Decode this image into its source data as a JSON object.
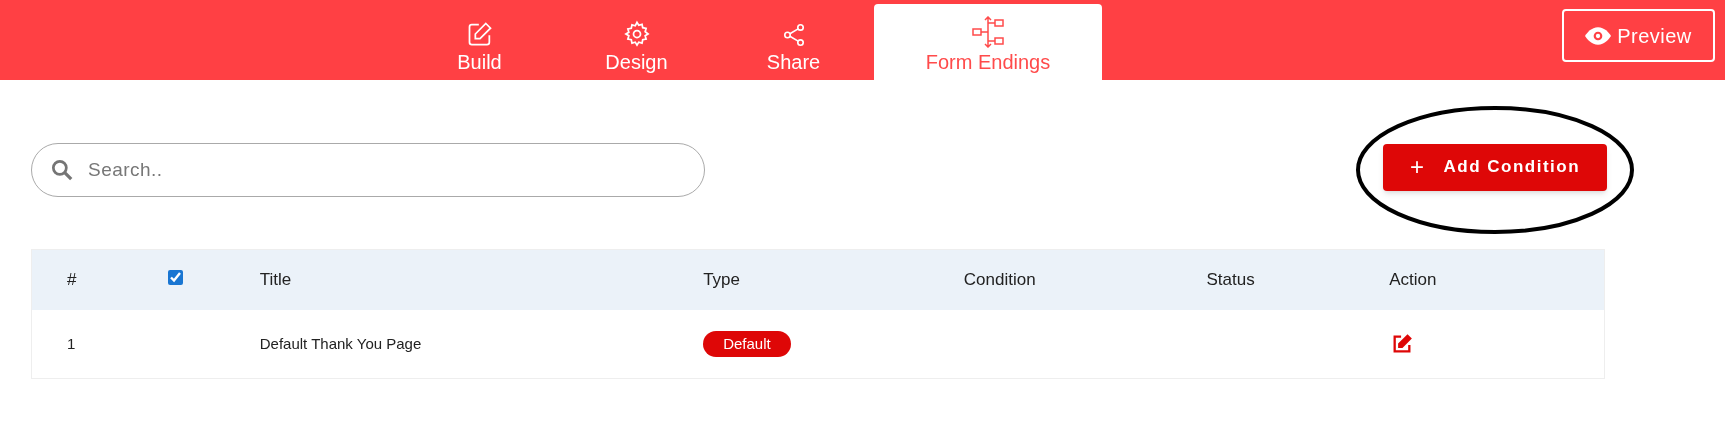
{
  "tabs": [
    {
      "label": "Build",
      "selected": false
    },
    {
      "label": "Design",
      "selected": false
    },
    {
      "label": "Share",
      "selected": false
    },
    {
      "label": "Form Endings",
      "selected": true
    }
  ],
  "preview_button": "Preview",
  "search": {
    "placeholder": "Search.."
  },
  "add_button": {
    "label": "Add Condition",
    "icon": "+"
  },
  "table": {
    "columns": [
      "#",
      "Title",
      "Type",
      "Condition",
      "Status",
      "Action"
    ],
    "select_all_checked": true,
    "rows": [
      {
        "number": "1",
        "title": "Default Thank You Page",
        "type": "Default"
      }
    ]
  }
}
